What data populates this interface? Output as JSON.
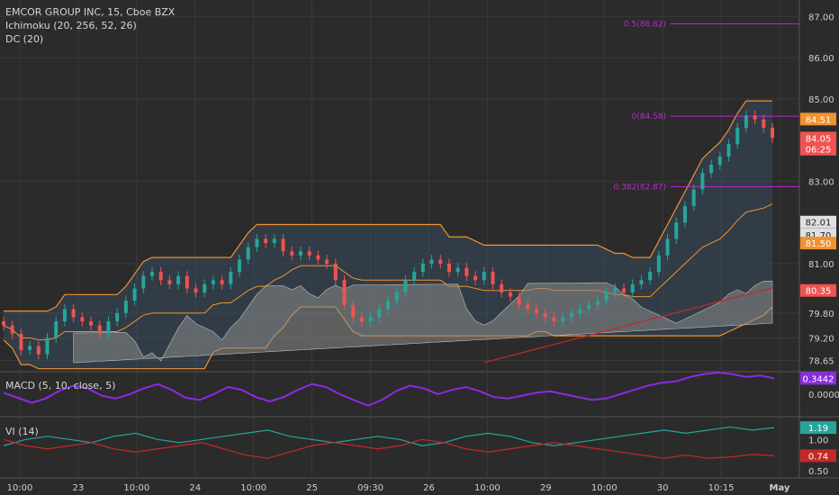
{
  "legend": {
    "symbol": "EMCOR GROUP INC, 15, Cboe BZX",
    "ichimoku": "Ichimoku (20, 256, 52, 26)",
    "dc": "DC (20)",
    "macd": "MACD (5, 10, close, 5)",
    "vi": "VI (14)"
  },
  "colors": {
    "background": "#2b2b2b",
    "grid": "#3a3a3a",
    "candle_up": "#26a69a",
    "candle_down": "#ef5350",
    "donchian": "#f0922e",
    "cloud": "#8a8a8a",
    "fib": "#c026d3",
    "macd": "#8a2be2",
    "vi_plus": "#26a69a",
    "vi_minus": "#c62828",
    "lagging": "#c62828"
  },
  "chart_data": [
    {
      "type": "candlestick",
      "name": "price",
      "x_ticks": [
        "10:00",
        "23",
        "10:00",
        "24",
        "10:00",
        "25",
        "09:30",
        "26",
        "10:00",
        "29",
        "10:00",
        "30",
        "10:15",
        "May"
      ],
      "y_ticks": [
        "87.00",
        "86.00",
        "85.00",
        "83.00",
        "81.00",
        "79.80",
        "79.20",
        "78.65"
      ],
      "ylim": [
        78.4,
        87.4
      ],
      "close": [
        79.5,
        79.3,
        78.9,
        79.0,
        78.8,
        79.2,
        79.6,
        79.9,
        79.7,
        79.6,
        79.5,
        79.3,
        79.6,
        79.8,
        80.1,
        80.4,
        80.7,
        80.8,
        80.6,
        80.5,
        80.7,
        80.4,
        80.3,
        80.5,
        80.6,
        80.5,
        80.8,
        81.1,
        81.4,
        81.6,
        81.5,
        81.6,
        81.3,
        81.2,
        81.3,
        81.2,
        81.1,
        81.0,
        80.6,
        80.0,
        79.7,
        79.6,
        79.7,
        79.9,
        80.1,
        80.3,
        80.6,
        80.8,
        81.0,
        81.1,
        81.0,
        80.8,
        80.9,
        80.7,
        80.6,
        80.8,
        80.5,
        80.3,
        80.2,
        80.0,
        79.9,
        79.8,
        79.7,
        79.6,
        79.7,
        79.8,
        79.9,
        80.0,
        80.1,
        80.3,
        80.4,
        80.3,
        80.5,
        80.6,
        80.8,
        81.2,
        81.6,
        82.0,
        82.4,
        82.8,
        83.2,
        83.4,
        83.6,
        83.9,
        84.3,
        84.6,
        84.5,
        84.3,
        84.05
      ],
      "annotations": [
        {
          "label": "0.5(86.82)",
          "value": 86.82
        },
        {
          "label": "0(84.58)",
          "value": 84.58
        },
        {
          "label": "0.382(82.87)",
          "value": 82.87
        }
      ],
      "price_labels": [
        {
          "text": "84.51",
          "value": 84.51,
          "color": "#f0922e"
        },
        {
          "text": "84.05",
          "value": 84.05,
          "color": "#ef5350"
        },
        {
          "text": "06:25",
          "value": 83.78,
          "color": "#ef5350"
        },
        {
          "text": "82.01",
          "value": 82.01,
          "color": "#e0e0e0"
        },
        {
          "text": "81.70",
          "value": 81.7,
          "color": "#e0e0e0"
        },
        {
          "text": "81.50",
          "value": 81.5,
          "color": "#f0922e"
        },
        {
          "text": "80.35",
          "value": 80.35,
          "color": "#ef5350"
        }
      ]
    },
    {
      "type": "line",
      "name": "macd",
      "y_ticks": [
        "0.0000"
      ],
      "ylim": [
        -0.3,
        0.3
      ],
      "values": [
        0.02,
        -0.05,
        -0.12,
        -0.06,
        0.05,
        0.12,
        0.08,
        -0.02,
        -0.06,
        0.0,
        0.08,
        0.14,
        0.06,
        -0.05,
        -0.08,
        0.0,
        0.1,
        0.06,
        -0.04,
        -0.1,
        -0.04,
        0.06,
        0.14,
        0.1,
        0.0,
        -0.08,
        -0.16,
        -0.08,
        0.04,
        0.12,
        0.08,
        0.0,
        0.06,
        0.1,
        0.04,
        -0.04,
        -0.06,
        -0.02,
        0.02,
        0.04,
        0.0,
        -0.04,
        -0.08,
        -0.06,
        0.0,
        0.06,
        0.12,
        0.16,
        0.18,
        0.24,
        0.28,
        0.3,
        0.28,
        0.24,
        0.26,
        0.22
      ],
      "price_labels": [
        {
          "text": "0.3442",
          "value": 0.22,
          "color": "#8a2be2"
        }
      ]
    },
    {
      "type": "line",
      "name": "vi",
      "y_ticks": [
        "1.00",
        "0.50"
      ],
      "ylim": [
        0.4,
        1.35
      ],
      "series": [
        {
          "values": [
            0.9,
            1.0,
            1.05,
            1.0,
            0.95,
            1.05,
            1.1,
            1.0,
            0.95,
            1.0,
            1.05,
            1.1,
            1.15,
            1.05,
            1.0,
            0.95,
            1.0,
            1.05,
            1.0,
            0.9,
            0.95,
            1.05,
            1.1,
            1.05,
            0.95,
            0.9,
            0.95,
            1.0,
            1.05,
            1.1,
            1.15,
            1.1,
            1.15,
            1.2,
            1.15,
            1.19
          ],
          "color": "#26a69a"
        },
        {
          "values": [
            1.0,
            0.9,
            0.85,
            0.9,
            0.95,
            0.85,
            0.8,
            0.85,
            0.9,
            0.95,
            0.85,
            0.75,
            0.7,
            0.8,
            0.9,
            0.95,
            0.9,
            0.85,
            0.9,
            1.0,
            0.95,
            0.85,
            0.8,
            0.85,
            0.9,
            0.95,
            0.9,
            0.85,
            0.8,
            0.75,
            0.7,
            0.75,
            0.7,
            0.72,
            0.76,
            0.74
          ],
          "color": "#c62828"
        }
      ],
      "price_labels": [
        {
          "text": "1.19",
          "value": 1.19,
          "color": "#26a69a"
        },
        {
          "text": "0.74",
          "value": 0.74,
          "color": "#c62828"
        }
      ]
    }
  ]
}
